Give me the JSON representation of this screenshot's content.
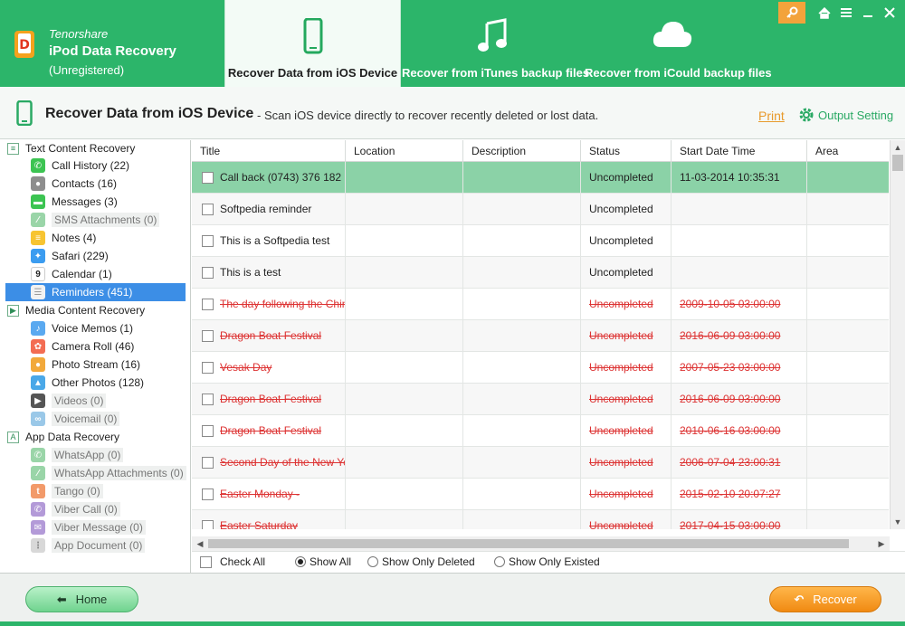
{
  "app": {
    "brand_company": "Tenorshare",
    "brand_product": "iPod Data Recovery",
    "brand_status": "(Unregistered)"
  },
  "nav_tabs": [
    {
      "label": "Recover Data from iOS Device",
      "icon": "phone-icon",
      "active": true
    },
    {
      "label": "Recover from iTunes backup files",
      "icon": "music-note-icon",
      "active": false
    },
    {
      "label": "Recover from iCould backup files",
      "icon": "cloud-icon",
      "active": false
    }
  ],
  "window_controls": [
    "key-icon",
    "home-icon",
    "menu-icon",
    "minimize-icon",
    "close-icon"
  ],
  "subheader": {
    "title": "Recover Data from iOS Device",
    "description": "- Scan iOS device directly to recover recently deleted or lost data.",
    "print_label": "Print",
    "output_label": "Output Setting"
  },
  "tree": {
    "groups": [
      {
        "label": "Text Content Recovery",
        "items": [
          {
            "label": "Call History (22)",
            "icon": "phone-icon",
            "color": "#3cc452",
            "dim": false
          },
          {
            "label": "Contacts (16)",
            "icon": "contacts-icon",
            "color": "#8e8e8e",
            "dim": false
          },
          {
            "label": "Messages (3)",
            "icon": "messages-icon",
            "color": "#3cc452",
            "dim": false
          },
          {
            "label": "SMS Attachments (0)",
            "icon": "attachment-icon",
            "color": "#9ad5a8",
            "dim": true
          },
          {
            "label": "Notes (4)",
            "icon": "notes-icon",
            "color": "#f7c431",
            "dim": false
          },
          {
            "label": "Safari (229)",
            "icon": "safari-icon",
            "color": "#3b9cf0",
            "dim": false
          },
          {
            "label": "Calendar (1)",
            "icon": "calendar-icon",
            "color": "#ffffff",
            "dim": false
          },
          {
            "label": "Reminders (451)",
            "icon": "reminders-icon",
            "color": "#f2f2f2",
            "dim": false,
            "selected": true
          }
        ]
      },
      {
        "label": "Media Content Recovery",
        "items": [
          {
            "label": "Voice Memos (1)",
            "icon": "microphone-icon",
            "color": "#5aa9f0",
            "dim": false
          },
          {
            "label": "Camera Roll (46)",
            "icon": "photos-icon",
            "color": "#f36d53",
            "dim": false
          },
          {
            "label": "Photo Stream (16)",
            "icon": "photo-stream-icon",
            "color": "#f2a93b",
            "dim": false
          },
          {
            "label": "Other Photos (128)",
            "icon": "other-photos-icon",
            "color": "#4aa8e8",
            "dim": false
          },
          {
            "label": "Videos (0)",
            "icon": "video-icon",
            "color": "#555555",
            "dim": true
          },
          {
            "label": "Voicemail (0)",
            "icon": "voicemail-icon",
            "color": "#9ac8e8",
            "dim": true
          }
        ]
      },
      {
        "label": "App Data Recovery",
        "items": [
          {
            "label": "WhatsApp (0)",
            "icon": "whatsapp-icon",
            "color": "#9ad5a8",
            "dim": true
          },
          {
            "label": "WhatsApp Attachments (0)",
            "icon": "whatsapp-attachment-icon",
            "color": "#9ad5a8",
            "dim": true
          },
          {
            "label": "Tango (0)",
            "icon": "tango-icon",
            "color": "#f29a6a",
            "dim": true
          },
          {
            "label": "Viber Call (0)",
            "icon": "viber-call-icon",
            "color": "#b39ad8",
            "dim": true
          },
          {
            "label": "Viber Message (0)",
            "icon": "viber-message-icon",
            "color": "#b39ad8",
            "dim": true
          },
          {
            "label": "App Document (0)",
            "icon": "app-document-icon",
            "color": "#d8d8d8",
            "dim": true
          }
        ]
      }
    ]
  },
  "table": {
    "columns": [
      "Title",
      "Location",
      "Description",
      "Status",
      "Start Date Time",
      "Area"
    ],
    "rows": [
      {
        "title": "Call back (0743) 376 182",
        "location": "",
        "description": "",
        "status": "Uncompleted",
        "start": "11-03-2014 10:35:31",
        "area": "",
        "deleted": false,
        "selected": true
      },
      {
        "title": "Softpedia reminder",
        "location": "",
        "description": "",
        "status": "Uncompleted",
        "start": "",
        "area": "",
        "deleted": false
      },
      {
        "title": "This is a Softpedia test",
        "location": "",
        "description": "",
        "status": "Uncompleted",
        "start": "",
        "area": "",
        "deleted": false
      },
      {
        "title": "This is a test",
        "location": "",
        "description": "",
        "status": "Uncompleted",
        "start": "",
        "area": "",
        "deleted": false
      },
      {
        "title": "The day following the Chines",
        "location": "",
        "description": "",
        "status": "Uncompleted",
        "start": "2009-10-05 03:00:00",
        "area": "",
        "deleted": true
      },
      {
        "title": "Dragon Boat Festival",
        "location": "",
        "description": "",
        "status": "Uncompleted",
        "start": "2016-06-09 03:00:00",
        "area": "",
        "deleted": true
      },
      {
        "title": "Vesak Day",
        "location": "",
        "description": "",
        "status": "Uncompleted",
        "start": "2007-05-23 03:00:00",
        "area": "",
        "deleted": true
      },
      {
        "title": "Dragon Boat Festival",
        "location": "",
        "description": "",
        "status": "Uncompleted",
        "start": "2016-06-09 03:00:00",
        "area": "",
        "deleted": true
      },
      {
        "title": "Dragon Boat Festival",
        "location": "",
        "description": "",
        "status": "Uncompleted",
        "start": "2010-06-16 03:00:00",
        "area": "",
        "deleted": true
      },
      {
        "title": "Second Day of the New Year",
        "location": "",
        "description": "",
        "status": "Uncompleted",
        "start": "2006-07-04 23:00:31",
        "area": "",
        "deleted": true
      },
      {
        "title": "Easter Monday -",
        "location": "",
        "description": "",
        "status": "Uncompleted",
        "start": "2015-02-10 20:07:27",
        "area": "",
        "deleted": true
      },
      {
        "title": "Easter Saturday",
        "location": "",
        "description": "",
        "status": "Uncompleted",
        "start": "2017-04-15 03:00:00",
        "area": "",
        "deleted": true
      }
    ]
  },
  "filters": {
    "check_all": "Check All",
    "show_all": "Show All",
    "show_deleted": "Show Only Deleted",
    "show_existed": "Show Only Existed",
    "selected": "show_all"
  },
  "footer": {
    "home_label": "Home",
    "recover_label": "Recover"
  },
  "colors": {
    "brand_green": "#2cb56a",
    "deleted_red": "#d33333",
    "selected_row": "#8bd2a7",
    "accent_orange": "#f08a12"
  }
}
